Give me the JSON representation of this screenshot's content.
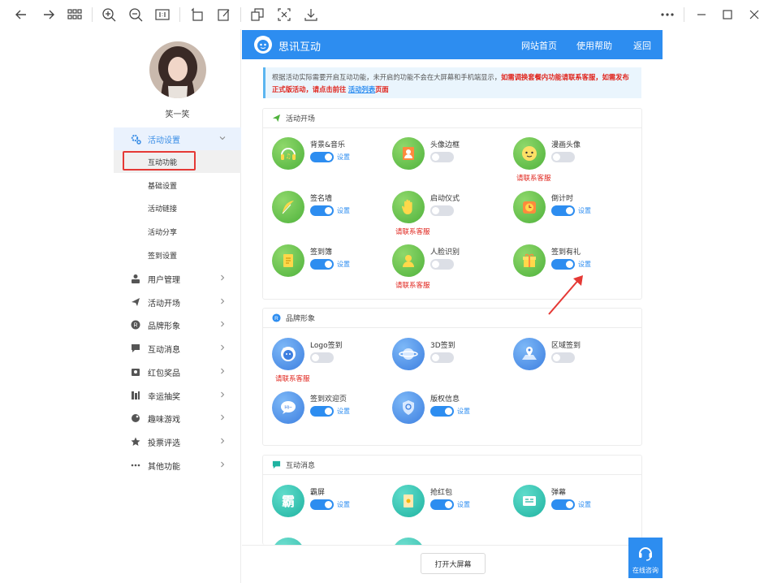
{
  "viewer_toolbar": {
    "icons": [
      "back-arrow-icon",
      "forward-arrow-icon",
      "grid-icon",
      "zoom-in-icon",
      "zoom-out-icon",
      "actual-size-icon",
      "rotate-icon",
      "edit-icon",
      "copy-icon",
      "crop-icon",
      "download-icon",
      "more-icon",
      "minimize-icon",
      "maximize-icon",
      "close-icon"
    ]
  },
  "sidebar": {
    "username": "笑一笑",
    "activity_settings": "活动设置",
    "sub_items": [
      "互动功能",
      "基础设置",
      "活动链接",
      "活动分享",
      "签到设置"
    ],
    "groups": [
      "用户管理",
      "活动开场",
      "品牌形象",
      "互动消息",
      "红包奖品",
      "幸运抽奖",
      "趣味游戏",
      "投票评选",
      "其他功能"
    ]
  },
  "header": {
    "title": "思讯互动",
    "links": [
      "网站首页",
      "使用帮助",
      "返回"
    ]
  },
  "notice": {
    "text1": "根据活动实际需要开启互动功能，未开启的功能不会在大屏幕和手机端显示，",
    "red1": "如需调换套餐内功能请联系客服，如需发布正式版活动，请点击前往",
    "link": "活动列表",
    "red2": "页面"
  },
  "sections": [
    {
      "title": "活动开场",
      "features": [
        {
          "name": "背景&音乐",
          "on": true,
          "set": "设置",
          "contact": ""
        },
        {
          "name": "头像边框",
          "on": false,
          "set": "",
          "contact": ""
        },
        {
          "name": "漫画头像",
          "on": false,
          "set": "",
          "contact": "请联系客服"
        },
        {
          "name": "签名墙",
          "on": true,
          "set": "设置",
          "contact": ""
        },
        {
          "name": "启动仪式",
          "on": false,
          "set": "",
          "contact": "请联系客服"
        },
        {
          "name": "倒计时",
          "on": true,
          "set": "设置",
          "contact": ""
        },
        {
          "name": "签到簿",
          "on": true,
          "set": "设置",
          "contact": ""
        },
        {
          "name": "人脸识别",
          "on": false,
          "set": "",
          "contact": "请联系客服"
        },
        {
          "name": "签到有礼",
          "on": true,
          "set": "设置",
          "contact": ""
        }
      ]
    },
    {
      "title": "品牌形象",
      "features": [
        {
          "name": "Logo签到",
          "on": false,
          "set": "",
          "contact": "请联系客服"
        },
        {
          "name": "3D签到",
          "on": false,
          "set": "",
          "contact": ""
        },
        {
          "name": "区域签到",
          "on": false,
          "set": "",
          "contact": ""
        },
        {
          "name": "签到欢迎页",
          "on": true,
          "set": "设置",
          "contact": ""
        },
        {
          "name": "版权信息",
          "on": true,
          "set": "设置",
          "contact": ""
        }
      ]
    },
    {
      "title": "互动消息",
      "features": [
        {
          "name": "霸屏",
          "on": true,
          "set": "设置",
          "contact": ""
        },
        {
          "name": "抢红包",
          "on": true,
          "set": "设置",
          "contact": ""
        },
        {
          "name": "弹幕",
          "on": true,
          "set": "设置",
          "contact": ""
        }
      ]
    }
  ],
  "bottom": {
    "big_screen": "打开大屏幕",
    "online": "在线咨询"
  },
  "colors": {
    "primary": "#2d8df0",
    "red": "#e0241c",
    "green": "#4fb23c",
    "teal": "#1fb3a1"
  }
}
